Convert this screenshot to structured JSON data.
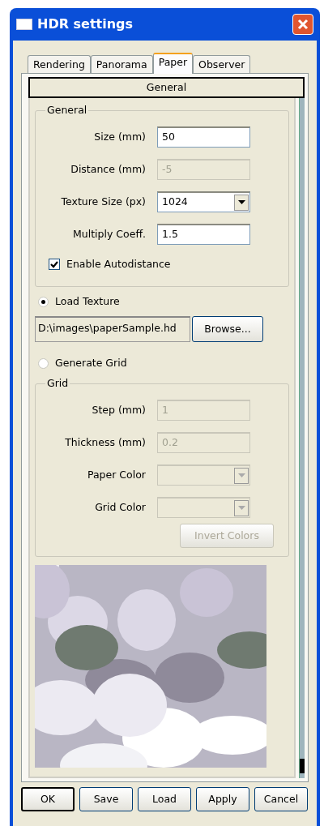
{
  "window": {
    "title": "HDR settings"
  },
  "tabs": [
    {
      "label": "Rendering",
      "selected": false
    },
    {
      "label": "Panorama",
      "selected": false
    },
    {
      "label": "Paper",
      "selected": true
    },
    {
      "label": "Observer",
      "selected": false
    }
  ],
  "section_header": "General",
  "general_group": {
    "title": "General",
    "fields": [
      {
        "kind": "text",
        "label": "Size (mm)",
        "value": "50",
        "disabled": false
      },
      {
        "kind": "text",
        "label": "Distance (mm)",
        "value": "-5",
        "disabled": true
      },
      {
        "kind": "dropdown",
        "label": "Texture Size (px)",
        "value": "1024",
        "disabled": false
      },
      {
        "kind": "text",
        "label": "Multiply Coeff.",
        "value": "1.5",
        "disabled": false
      }
    ],
    "autodistance": {
      "label": "Enable Autodistance",
      "checked": true
    }
  },
  "load_texture": {
    "label": "Load Texture",
    "selected": true,
    "path": "D:\\images\\paperSample.hd",
    "browse_button": "Browse..."
  },
  "generate_grid": {
    "label": "Generate Grid",
    "selected": false
  },
  "grid_group": {
    "title": "Grid",
    "fields": [
      {
        "kind": "text",
        "label": "Step (mm)",
        "value": "1",
        "disabled": true
      },
      {
        "kind": "text",
        "label": "Thickness (mm)",
        "value": "0.2",
        "disabled": true
      },
      {
        "kind": "dropdown",
        "label": "Paper Color",
        "disabled": true
      },
      {
        "kind": "dropdown",
        "label": "Grid Color",
        "disabled": true
      }
    ],
    "invert_button": {
      "label": "Invert Colors",
      "disabled": true
    }
  },
  "buttons": [
    {
      "label": "OK",
      "default": true
    },
    {
      "label": "Save",
      "default": false
    },
    {
      "label": "Load",
      "default": false
    },
    {
      "label": "Apply",
      "default": false
    },
    {
      "label": "Cancel",
      "default": false
    }
  ]
}
